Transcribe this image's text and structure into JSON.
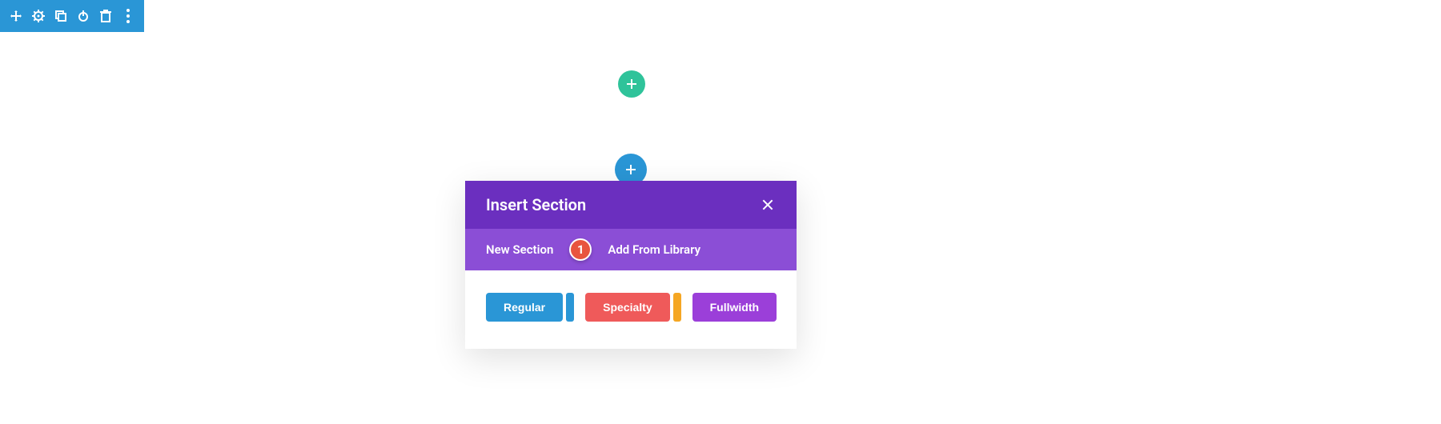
{
  "toolbar": {
    "icons": [
      "move",
      "gear",
      "duplicate",
      "power",
      "trash",
      "more"
    ]
  },
  "modal": {
    "title": "Insert Section",
    "tabs": {
      "new_section": "New Section",
      "add_from_library": "Add From Library"
    },
    "badge": "1",
    "buttons": {
      "regular": "Regular",
      "specialty": "Specialty",
      "fullwidth": "Fullwidth"
    }
  },
  "colors": {
    "toolbar": "#2a96d6",
    "green": "#2fc39a",
    "blue": "#2a96d6",
    "purple_dark": "#6b2fbf",
    "purple_light": "#8b4ed6",
    "badge": "#e8543f",
    "regular": "#2a96d6",
    "specialty": "#ef5a5a",
    "specialty_stripe": "#f5a623",
    "fullwidth": "#9b3fd9"
  }
}
